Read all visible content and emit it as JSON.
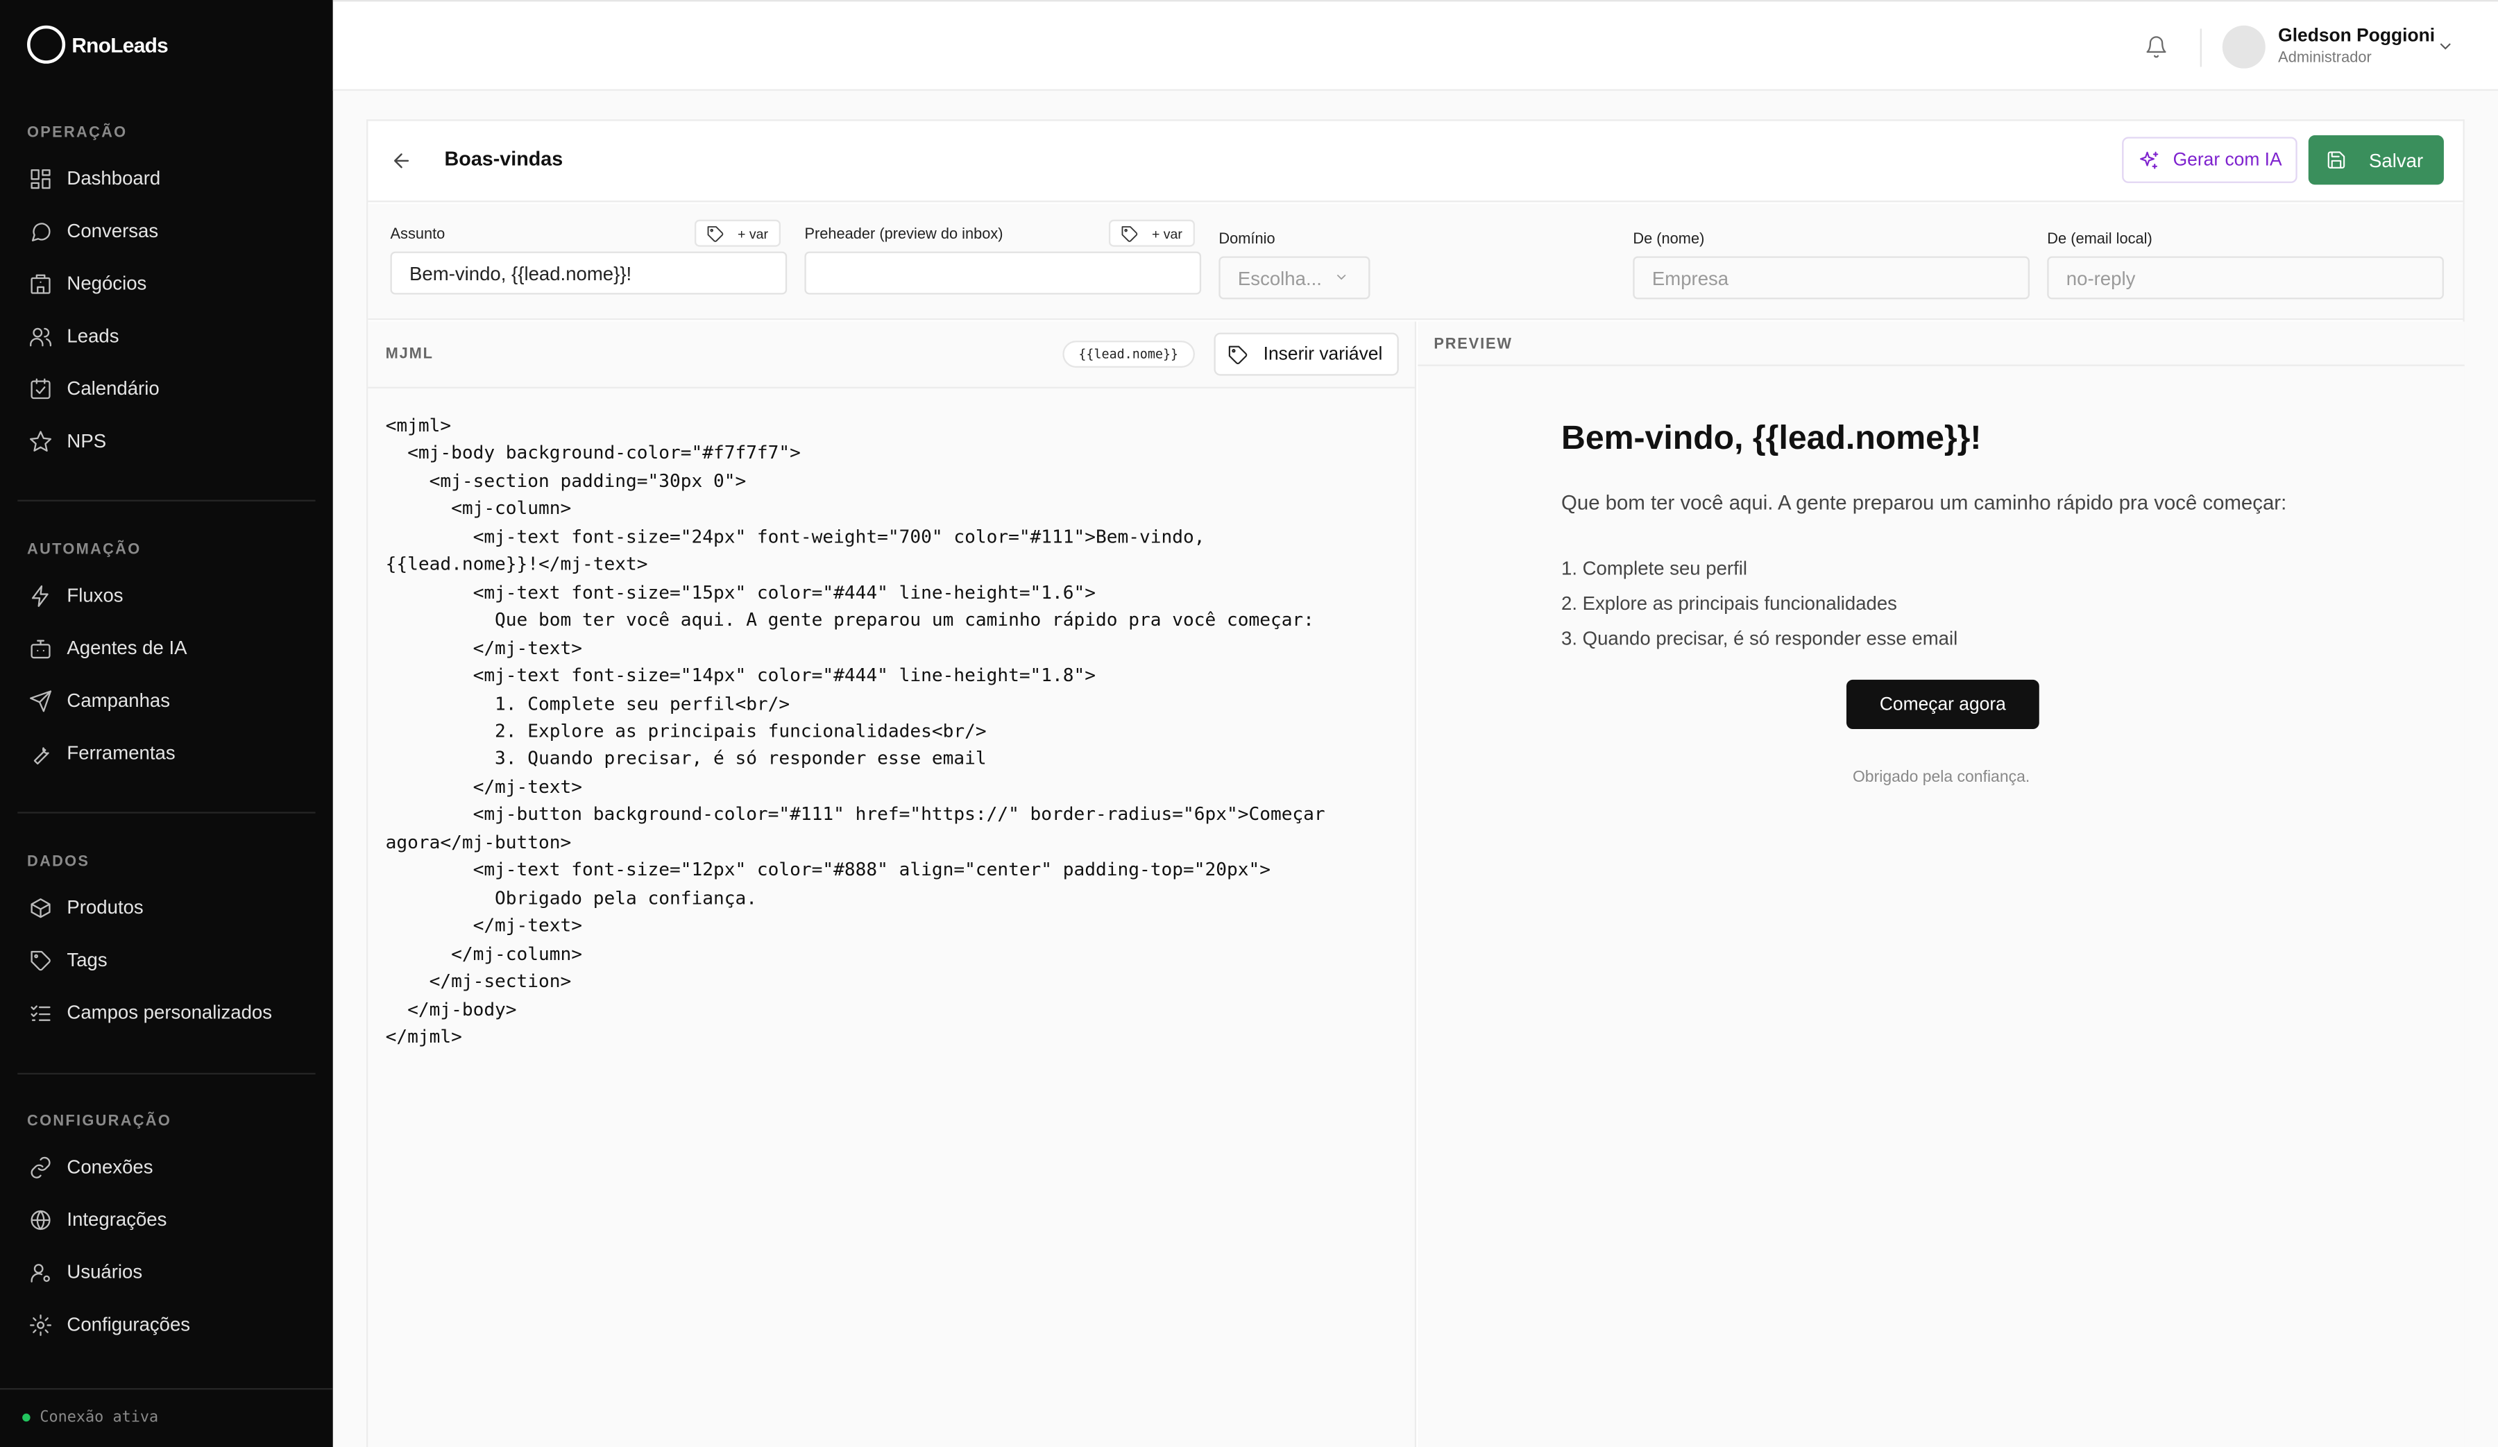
{
  "brand": {
    "name": "RnoLeads"
  },
  "sidebar": {
    "sections": [
      {
        "label": "OPERAÇÃO",
        "items": [
          {
            "label": "Dashboard",
            "icon": "grid-icon"
          },
          {
            "label": "Conversas",
            "icon": "chat-icon"
          },
          {
            "label": "Negócios",
            "icon": "building-icon"
          },
          {
            "label": "Leads",
            "icon": "users-icon"
          },
          {
            "label": "Calendário",
            "icon": "calendar-check-icon"
          },
          {
            "label": "NPS",
            "icon": "star-icon"
          }
        ]
      },
      {
        "label": "AUTOMAÇÃO",
        "items": [
          {
            "label": "Fluxos",
            "icon": "zap-icon"
          },
          {
            "label": "Agentes de IA",
            "icon": "bot-icon"
          },
          {
            "label": "Campanhas",
            "icon": "send-icon"
          },
          {
            "label": "Ferramentas",
            "icon": "wrench-icon"
          }
        ]
      },
      {
        "label": "DADOS",
        "items": [
          {
            "label": "Produtos",
            "icon": "package-icon"
          },
          {
            "label": "Tags",
            "icon": "tag-icon"
          },
          {
            "label": "Campos personalizados",
            "icon": "list-check-icon"
          }
        ]
      },
      {
        "label": "CONFIGURAÇÃO",
        "items": [
          {
            "label": "Conexões",
            "icon": "link-icon"
          },
          {
            "label": "Integrações",
            "icon": "globe-icon"
          },
          {
            "label": "Usuários",
            "icon": "user-cog-icon"
          },
          {
            "label": "Configurações",
            "icon": "gear-icon"
          }
        ]
      }
    ],
    "status": "Conexão ativa"
  },
  "topbar": {
    "user_name": "Gledson Poggioni",
    "user_role": "Administrador"
  },
  "editor": {
    "title": "Boas-vindas",
    "generate_label": "Gerar com IA",
    "save_label": "Salvar",
    "fields": {
      "subject_label": "Assunto",
      "subject_value": "Bem-vindo, {{lead.nome}}!",
      "var_chip": "+ var",
      "preheader_label": "Preheader (preview do inbox)",
      "preheader_value": "",
      "domain_label": "Domínio",
      "domain_placeholder": "Escolha...",
      "from_name_label": "De (nome)",
      "from_name_placeholder": "Empresa",
      "from_email_label": "De (email local)",
      "from_email_placeholder": "no-reply"
    },
    "mjml_label": "MJML",
    "lead_chip": "{{lead.nome}}",
    "insert_variable_label": "Inserir variável",
    "code": "<mjml>\n  <mj-body background-color=\"#f7f7f7\">\n    <mj-section padding=\"30px 0\">\n      <mj-column>\n        <mj-text font-size=\"24px\" font-weight=\"700\" color=\"#111\">Bem-vindo,\n{{lead.nome}}!</mj-text>\n        <mj-text font-size=\"15px\" color=\"#444\" line-height=\"1.6\">\n          Que bom ter você aqui. A gente preparou um caminho rápido pra você começar:\n        </mj-text>\n        <mj-text font-size=\"14px\" color=\"#444\" line-height=\"1.8\">\n          1. Complete seu perfil<br/>\n          2. Explore as principais funcionalidades<br/>\n          3. Quando precisar, é só responder esse email\n        </mj-text>\n        <mj-button background-color=\"#111\" href=\"https://\" border-radius=\"6px\">Começar\nagora</mj-button>\n        <mj-text font-size=\"12px\" color=\"#888\" align=\"center\" padding-top=\"20px\">\n          Obrigado pela confiança.\n        </mj-text>\n      </mj-column>\n    </mj-section>\n  </mj-body>\n</mjml>"
  },
  "preview": {
    "label": "PREVIEW",
    "title": "Bem-vindo, {{lead.nome}}!",
    "intro": "Que bom ter você aqui. A gente preparou um caminho rápido pra você começar:",
    "list": [
      "1. Complete seu perfil",
      "2. Explore as principais funcionalidades",
      "3. Quando precisar, é só responder esse email"
    ],
    "button": "Começar agora",
    "footer": "Obrigado pela confiança."
  },
  "colors": {
    "sidebar_bg": "#0b0b0b",
    "save_green": "#3a8f5c",
    "ai_purple": "#7e22ce",
    "status_green": "#22c55e"
  }
}
